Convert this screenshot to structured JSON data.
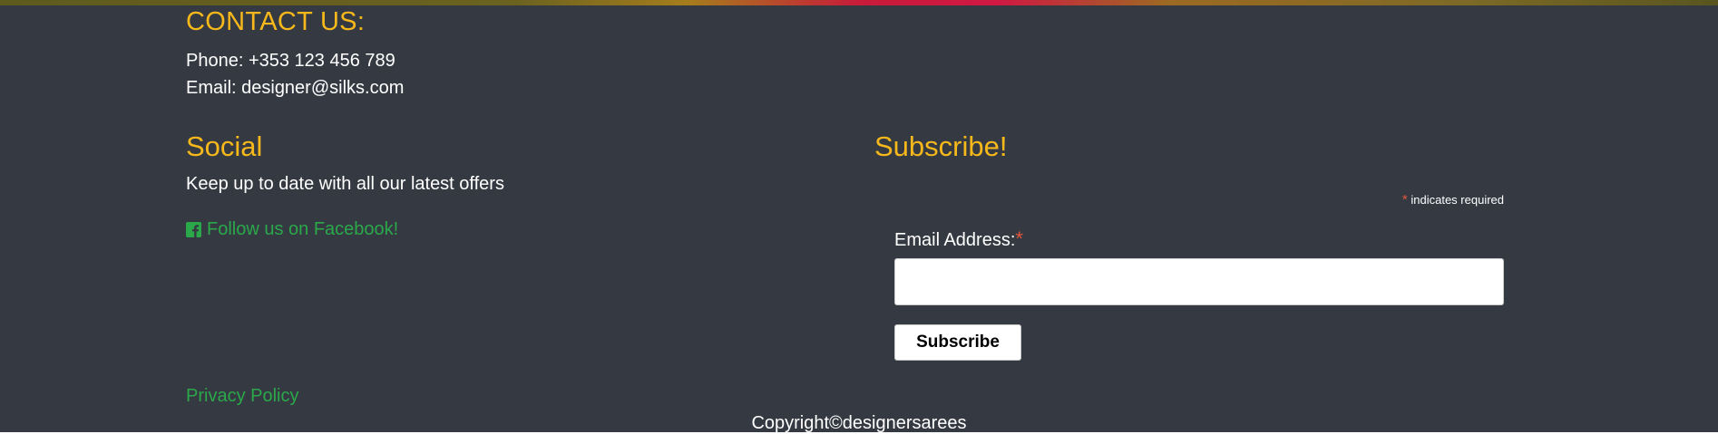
{
  "contact": {
    "title": "CONTACT US:",
    "phone": "Phone: +353 123 456 789",
    "email": "Email: designer@silks.com"
  },
  "social": {
    "title": "Social",
    "text": "Keep up to date with all our latest offers",
    "facebook_link": "Follow us on Facebook!",
    "facebook_icon": "facebook-square-icon"
  },
  "subscribe": {
    "title": "Subscribe!",
    "required_star": "*",
    "required_note": "indicates required",
    "email_label": "Email Address:",
    "email_value": "",
    "button_label": "Subscribe"
  },
  "footer": {
    "privacy_link": "Privacy Policy",
    "copyright": "Copyright©designersarees"
  },
  "colors": {
    "background": "#353a42",
    "heading": "#f6b81a",
    "link": "#2aa84a",
    "required": "#e2543e"
  }
}
